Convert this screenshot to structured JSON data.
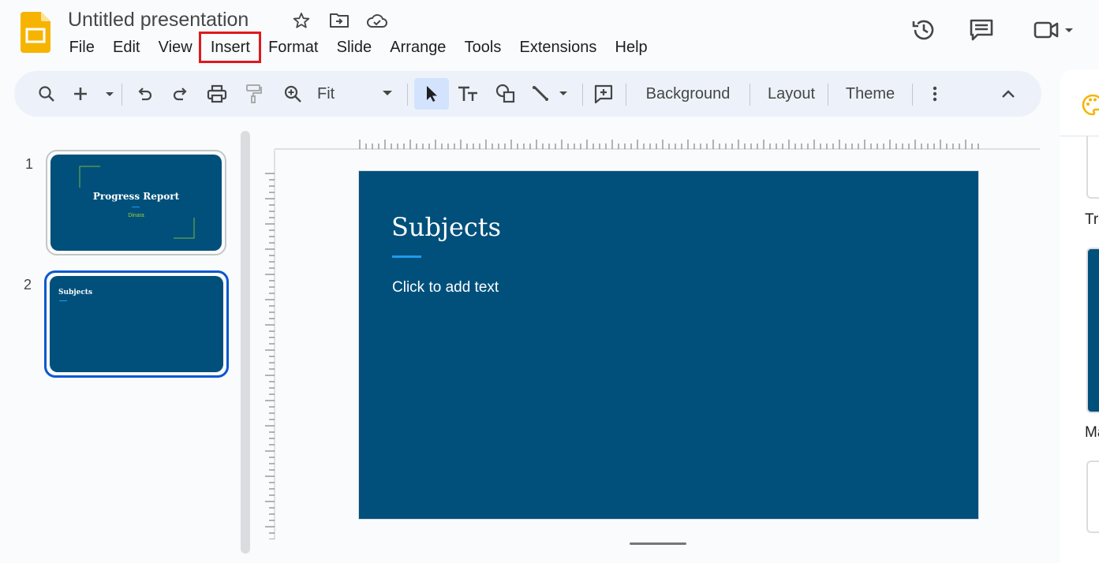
{
  "document": {
    "title": "Untitled presentation"
  },
  "menu": {
    "items": [
      "File",
      "Edit",
      "View",
      "Insert",
      "Format",
      "Slide",
      "Arrange",
      "Tools",
      "Extensions",
      "Help"
    ],
    "highlighted": "Insert"
  },
  "toolbar": {
    "zoom_value": "Fit",
    "background_label": "Background",
    "layout_label": "Layout",
    "theme_label": "Theme"
  },
  "filmstrip": {
    "slides": [
      {
        "number": "1",
        "title": "Progress Report",
        "subtitle": "Dinara"
      },
      {
        "number": "2",
        "title": "Subjects"
      }
    ]
  },
  "slide": {
    "title": "Subjects",
    "body_placeholder": "Click to add text"
  },
  "right_panel": {
    "label_1": "Tr",
    "label_2": "Ma"
  },
  "colors": {
    "slide_bg": "#00507b",
    "accent_line": "#1e9bf0",
    "thumb_subtitle": "#9ccc3c",
    "selection_border": "#0b57d0",
    "highlight_box": "#e0191d",
    "logo_yellow": "#f6b400"
  },
  "icons": {
    "header": [
      "star-icon",
      "move-to-folder-icon",
      "cloud-saved-icon",
      "history-icon",
      "comments-icon",
      "meet-video-icon"
    ],
    "toolbar": [
      "search-icon",
      "new-slide-icon",
      "undo-icon",
      "redo-icon",
      "print-icon",
      "paint-format-icon",
      "zoom-icon",
      "select-cursor-icon",
      "text-box-icon",
      "shape-icon",
      "line-icon",
      "add-comment-icon",
      "more-options-icon",
      "collapse-icon"
    ],
    "right_panel": [
      "theme-palette-icon"
    ]
  }
}
